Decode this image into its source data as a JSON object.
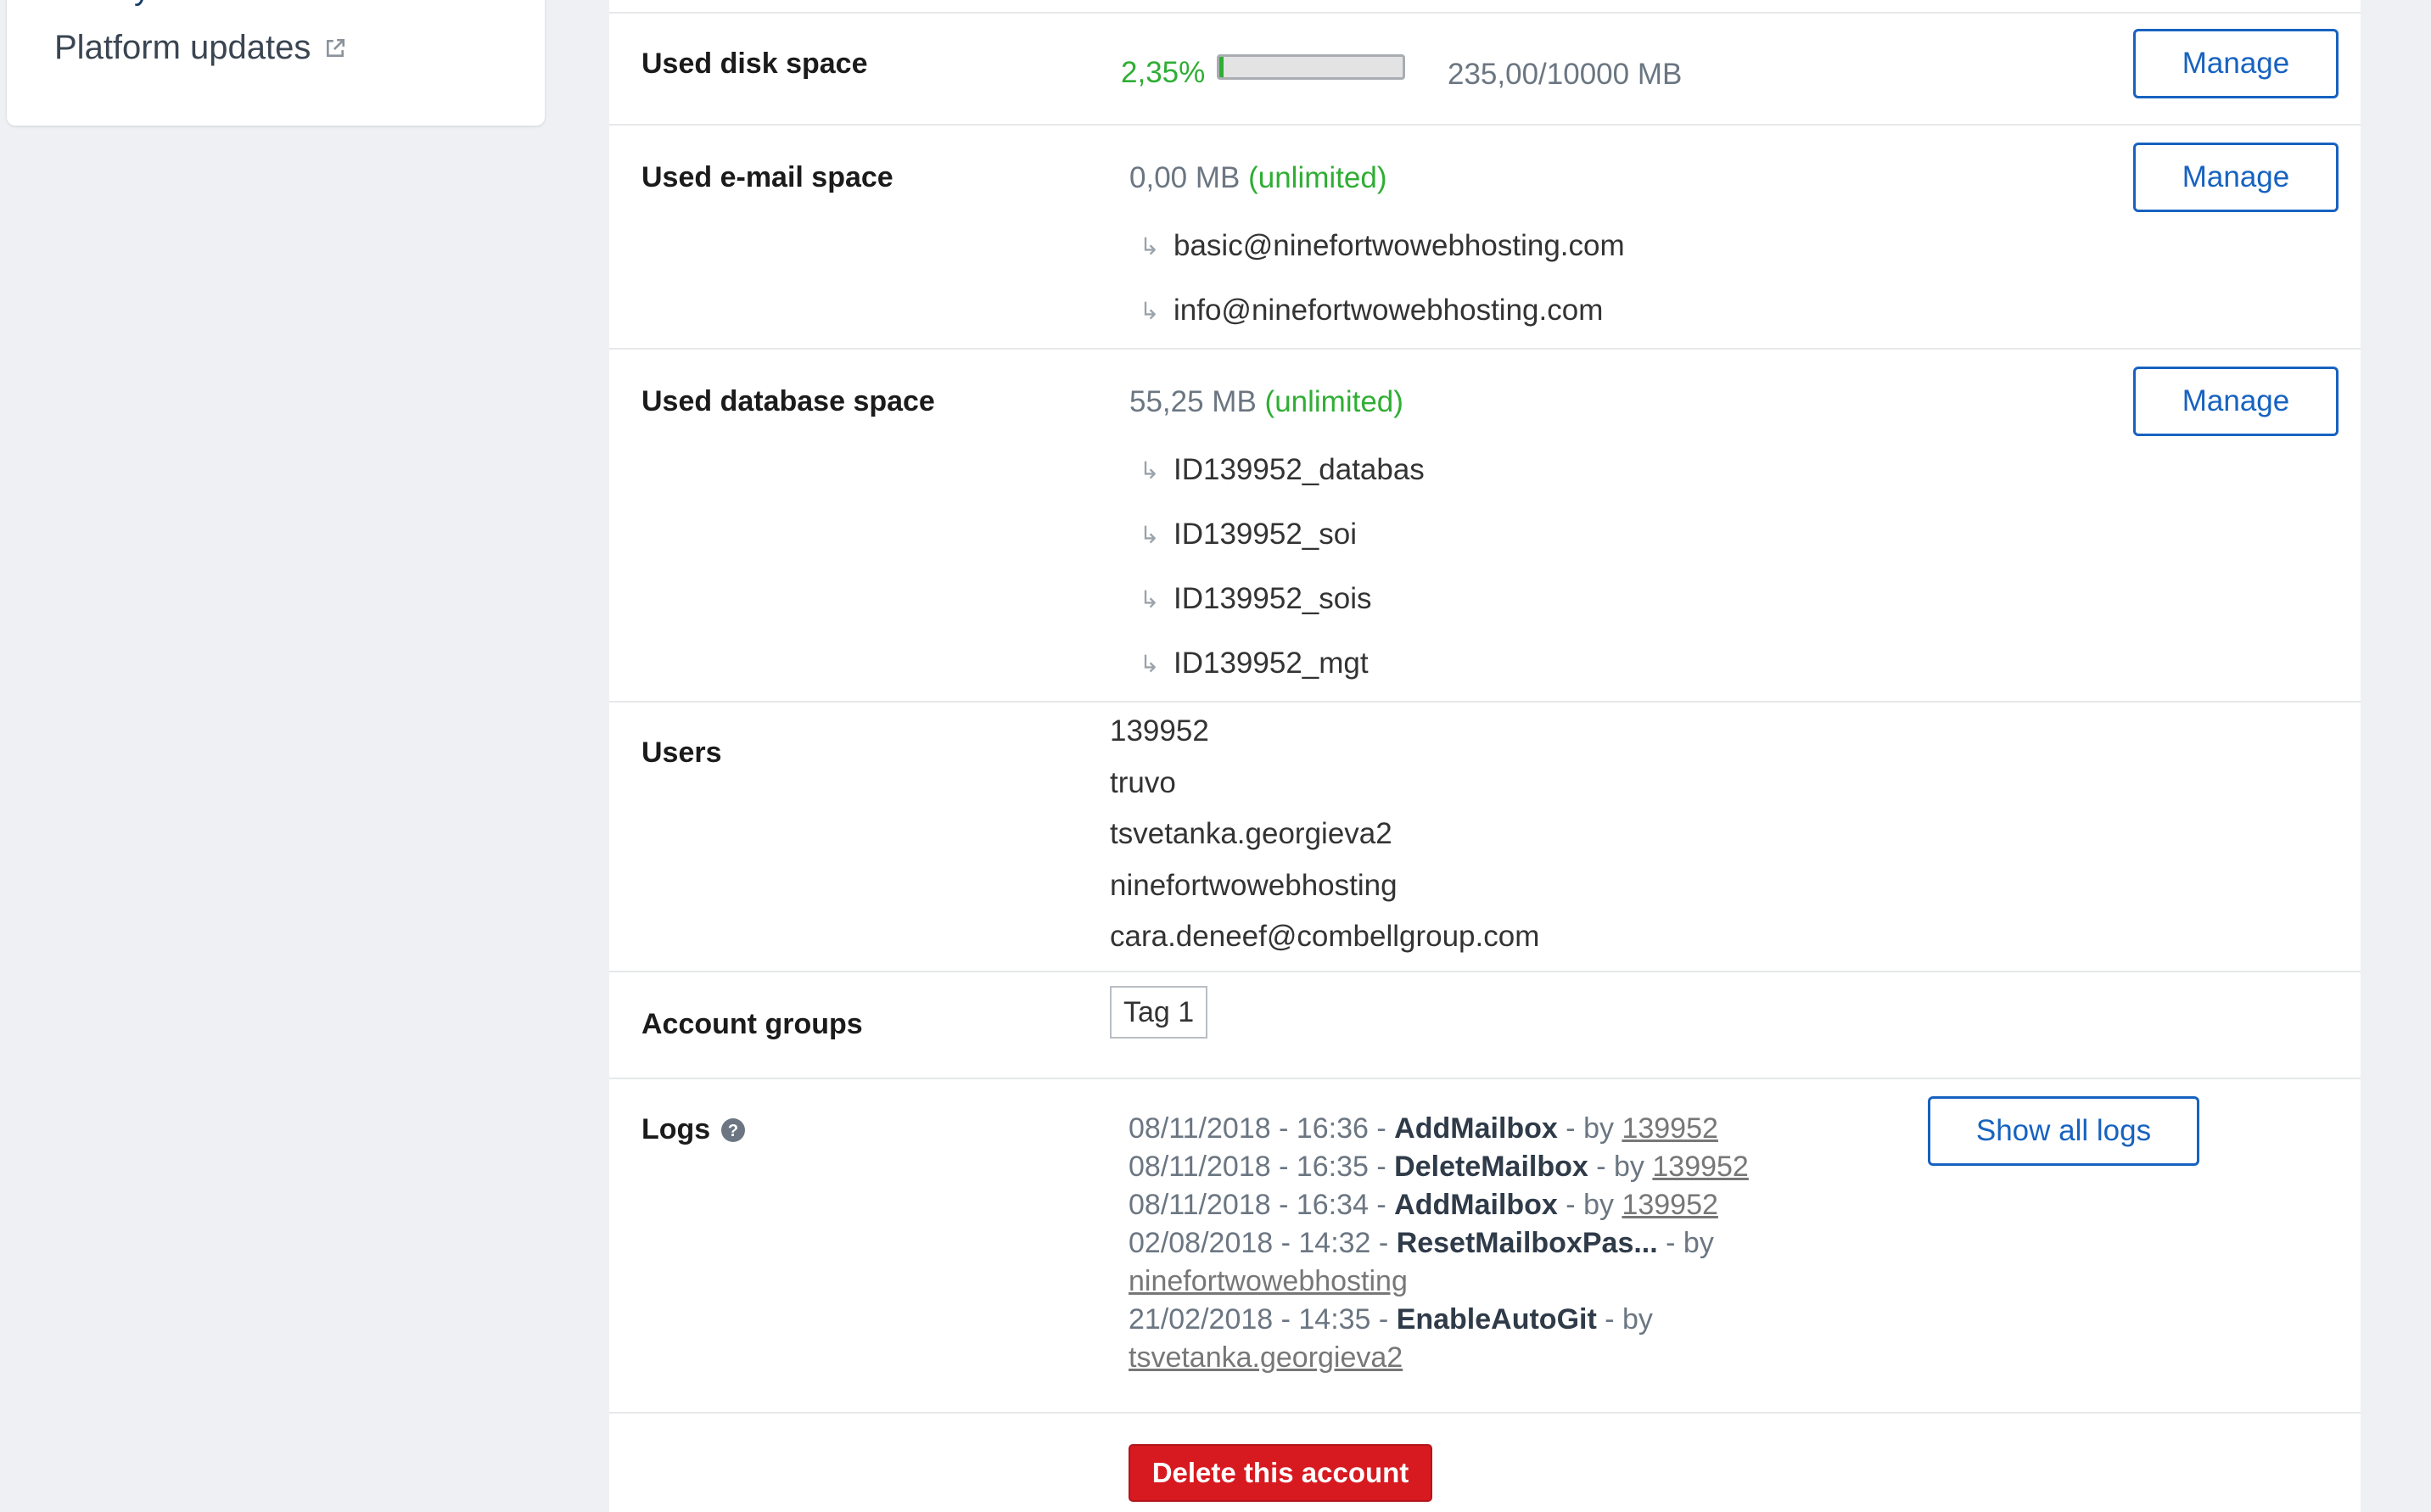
{
  "sidebar": {
    "partial_item": "y",
    "platform_updates": "Platform updates",
    "platform_updates_icon": "external-link-icon"
  },
  "disk": {
    "label": "Used disk space",
    "percent": "2,35%",
    "progress_fraction": 0.0235,
    "usage": "235,00/10000 MB",
    "manage": "Manage"
  },
  "email": {
    "label": "Used e-mail space",
    "amount": "0,00 MB",
    "limit": "(unlimited)",
    "manage": "Manage",
    "items": [
      "basic@ninefortwowebhosting.com",
      "info@ninefortwowebhosting.com"
    ]
  },
  "database": {
    "label": "Used database space",
    "amount": "55,25 MB",
    "limit": "(unlimited)",
    "manage": "Manage",
    "items": [
      "ID139952_databas",
      "ID139952_soi",
      "ID139952_sois",
      "ID139952_mgt"
    ]
  },
  "users": {
    "label": "Users",
    "items": [
      "139952",
      "truvo",
      "tsvetanka.georgieva2",
      "ninefortwowebhosting",
      "cara.deneef@combellgroup.com"
    ]
  },
  "groups": {
    "label": "Account groups",
    "tags": [
      "Tag 1"
    ]
  },
  "logs": {
    "label": "Logs",
    "help_icon": "help-circle-icon",
    "show_all": "Show all logs",
    "by": "by",
    "entries": [
      {
        "time": "08/11/2018 - 16:36",
        "action": "AddMailbox",
        "user": "139952"
      },
      {
        "time": "08/11/2018 - 16:35",
        "action": "DeleteMailbox",
        "user": "139952"
      },
      {
        "time": "08/11/2018 - 16:34",
        "action": "AddMailbox",
        "user": "139952"
      },
      {
        "time": "02/08/2018 - 14:32",
        "action": "ResetMailboxPas...",
        "user": "ninefortwowebhosting"
      },
      {
        "time": "21/02/2018 - 14:35",
        "action": "EnableAutoGit",
        "user": "tsvetanka.georgieva2"
      }
    ]
  },
  "delete_button": "Delete this account",
  "colors": {
    "accent": "#1762c0",
    "success": "#2fae34",
    "danger": "#d71920"
  }
}
